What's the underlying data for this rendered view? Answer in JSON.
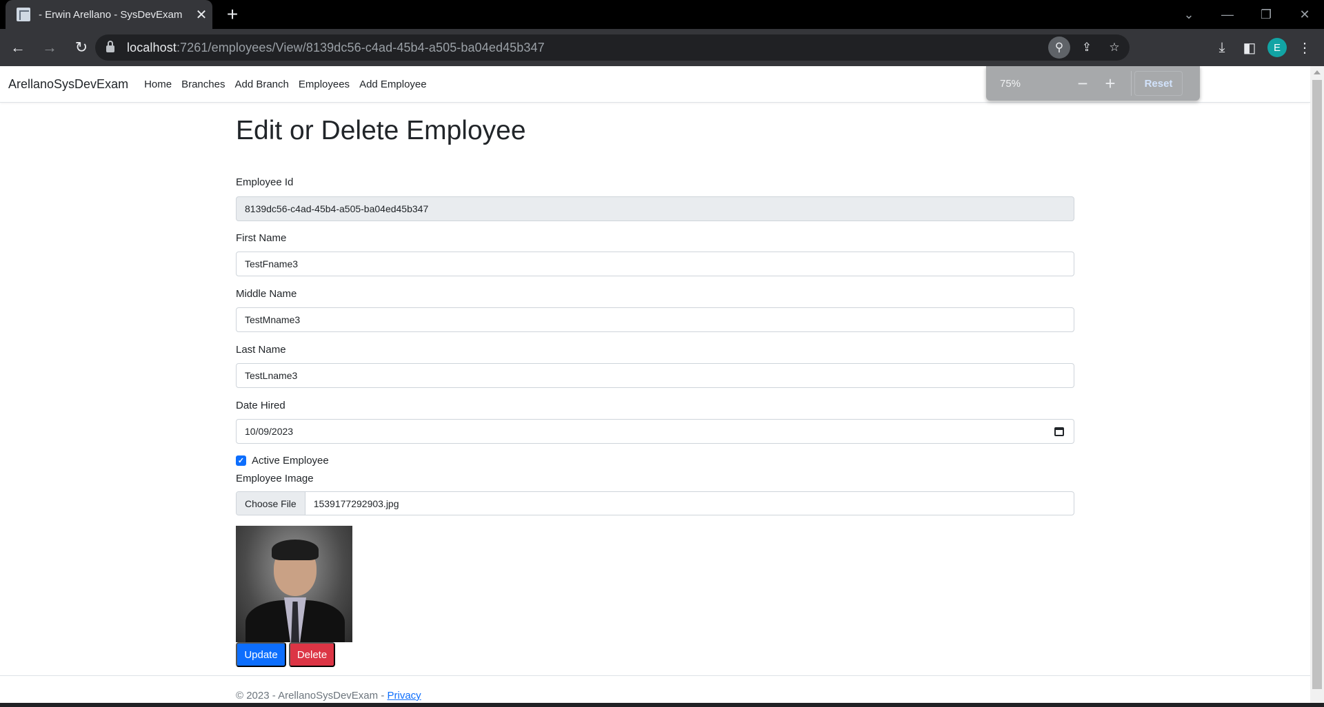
{
  "browser": {
    "tab_title": "- Erwin Arellano - SysDevExam",
    "url_host": "localhost",
    "url_rest": ":7261/employees/View/8139dc56-c4ad-45b4-a505-ba04ed45b347",
    "profile_initial": "E",
    "zoom": {
      "level": "75%",
      "minus": "−",
      "plus": "+",
      "reset_label": "Reset"
    }
  },
  "navbar": {
    "brand": "ArellanoSysDevExam",
    "links": [
      "Home",
      "Branches",
      "Add Branch",
      "Employees",
      "Add Employee"
    ]
  },
  "page": {
    "title": "Edit or Delete Employee"
  },
  "form": {
    "employee_id": {
      "label": "Employee Id",
      "value": "8139dc56-c4ad-45b4-a505-ba04ed45b347"
    },
    "first_name": {
      "label": "First Name",
      "value": "TestFname3"
    },
    "middle_name": {
      "label": "Middle Name",
      "value": "TestMname3"
    },
    "last_name": {
      "label": "Last Name",
      "value": "TestLname3"
    },
    "date_hired": {
      "label": "Date Hired",
      "value": "10/09/2023"
    },
    "active": {
      "label": "Active Employee",
      "checked": true
    },
    "image": {
      "label": "Employee Image",
      "button": "Choose File",
      "file_name": "1539177292903.jpg"
    },
    "update_label": "Update",
    "delete_label": "Delete"
  },
  "footer": {
    "text": "© 2023 - ArellanoSysDevExam - ",
    "privacy_link": "Privacy"
  },
  "colors": {
    "primary": "#0d6efd",
    "danger": "#dc3545",
    "readonly_bg": "#e9ecef"
  }
}
